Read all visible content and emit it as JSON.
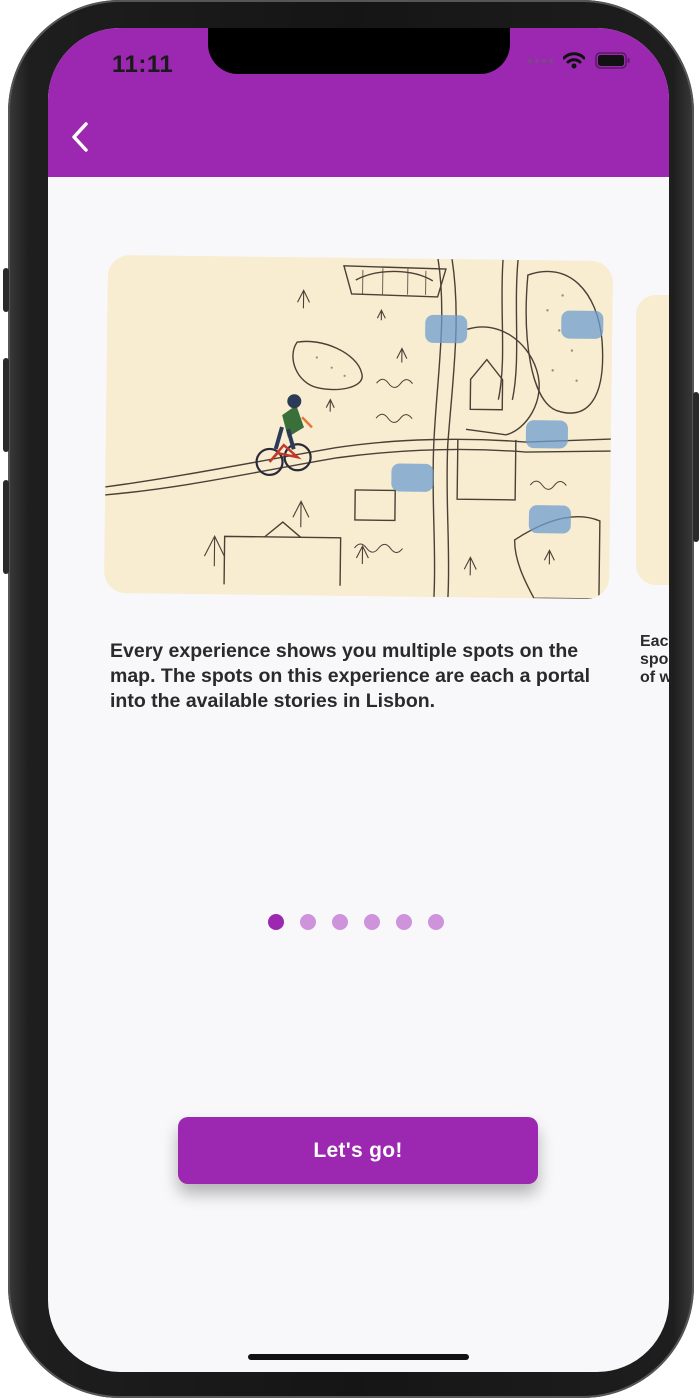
{
  "status_bar": {
    "time": "11:11",
    "icons": [
      "signal-dots-icon",
      "wifi-icon",
      "battery-icon"
    ]
  },
  "app_bar": {
    "color": "#9c27b0",
    "back_icon": "back-arrow-icon"
  },
  "onboarding": {
    "slides": [
      {
        "image": "illustrated-map-with-cyclist",
        "text": "Every experience shows you multiple spots on the map. The spots on this experience are each a portal into the available stories in Lisbon."
      },
      {
        "image": "illustration-partial",
        "text": "Eac\nspo\nof w"
      }
    ],
    "page_count": 6,
    "current_page": 1,
    "cta_label": "Let's go!"
  },
  "colors": {
    "accent": "#9c27b0",
    "dot_inactive": "#cf93dc",
    "background": "#f8f8fa"
  }
}
